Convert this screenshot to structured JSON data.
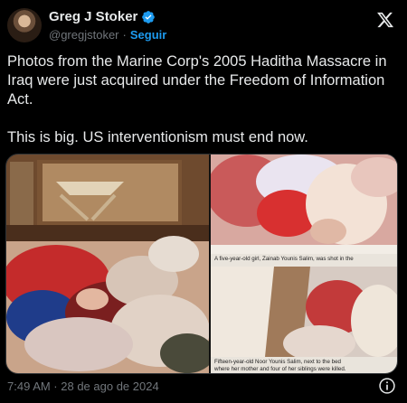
{
  "author": {
    "name": "Greg J Stoker",
    "handle": "@gregjstoker",
    "separator": "·",
    "follow_label": "Seguir"
  },
  "tweet": {
    "text": "Photos from the Marine Corp's 2005 Haditha Massacre in Iraq were just acquired under the Freedom of Information Act.\n\nThis is big. US interventionism must end now."
  },
  "media": {
    "caption_top": "A five-year-old girl, Zainab Younis Salim, was shot in the",
    "caption_bottom_line1": "Fifteen-year-old Noor Younis Salim, next to the bed",
    "caption_bottom_line2": "where her mother and four of her siblings were killed."
  },
  "footer": {
    "timestamp": "7:49 AM · 28 de ago de 2024"
  },
  "icons": {
    "verified": "verified-badge-icon",
    "platform": "x-logo-icon",
    "info": "info-icon"
  },
  "colors": {
    "background": "#000000",
    "text": "#e7e9ea",
    "secondary": "#71767b",
    "accent": "#1d9bf0"
  }
}
